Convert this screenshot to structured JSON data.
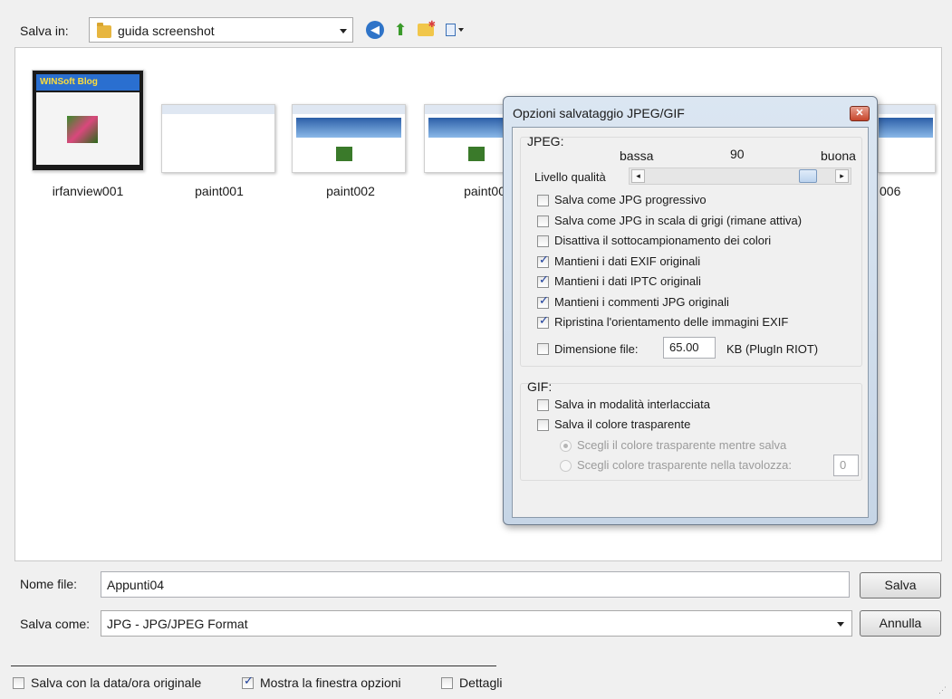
{
  "toolbar": {
    "save_in_label": "Salva in:",
    "folder": "guida screenshot",
    "icons": [
      "back-icon",
      "up-folder-icon",
      "new-folder-icon",
      "view-menu-icon"
    ]
  },
  "files": [
    {
      "name": "irfanview001",
      "logo": "WINSoft Blog"
    },
    {
      "name": "paint001"
    },
    {
      "name": "paint002"
    },
    {
      "name": "paint00"
    },
    {
      "name": "006"
    }
  ],
  "bottom": {
    "filename_label": "Nome file:",
    "filename_value": "Appunti04",
    "savetype_label": "Salva come:",
    "savetype_value": "JPG - JPG/JPEG Format",
    "save_button": "Salva",
    "cancel_button": "Annulla",
    "checks": [
      {
        "label": "Salva con la data/ora originale",
        "checked": false
      },
      {
        "label": "Mostra la finestra opzioni",
        "checked": true
      },
      {
        "label": "Dettagli",
        "checked": false
      }
    ]
  },
  "dialog": {
    "title": "Opzioni salvataggio JPEG/GIF",
    "jpeg_group": "JPEG:",
    "quality_low": "bassa",
    "quality_value": "90",
    "quality_high": "buona",
    "quality_label": "Livello qualità",
    "quality_fraction": 0.9,
    "jpeg_options": [
      {
        "label": "Salva come JPG progressivo",
        "checked": false
      },
      {
        "label": "Salva come JPG in scala di grigi (rimane attiva)",
        "checked": false
      },
      {
        "label": "Disattiva il sottocampionamento dei colori",
        "checked": false
      },
      {
        "label": "Mantieni i dati EXIF originali",
        "checked": true
      },
      {
        "label": "Mantieni i dati IPTC originali",
        "checked": true
      },
      {
        "label": "Mantieni i commenti JPG originali",
        "checked": true
      },
      {
        "label": "Ripristina l'orientamento delle immagini EXIF",
        "checked": true
      }
    ],
    "filesize_label": "Dimensione file:",
    "filesize_value": "65.00",
    "filesize_unit": "KB (PlugIn RIOT)",
    "gif_group": "GIF:",
    "gif_options": [
      {
        "label": "Salva in modalità interlacciata",
        "checked": false
      },
      {
        "label": "Salva il colore trasparente",
        "checked": false
      }
    ],
    "gif_radios": [
      {
        "label": "Scegli il colore trasparente mentre salva",
        "selected": true
      },
      {
        "label": "Scegli colore trasparente nella tavolozza:",
        "selected": false
      }
    ],
    "palette_index": "0"
  }
}
